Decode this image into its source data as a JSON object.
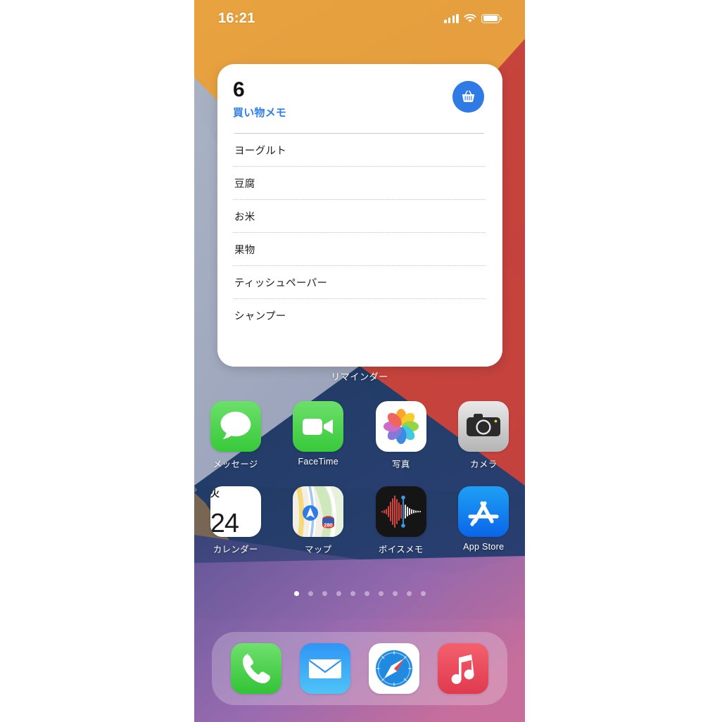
{
  "status_bar": {
    "time": "16:21",
    "signal_icon": "cellular-signal-icon",
    "wifi_icon": "wifi-icon",
    "battery_icon": "battery-full-icon"
  },
  "widget": {
    "count": "6",
    "title": "買い物メモ",
    "app_label": "リマインダー",
    "accent_color": "#2f7ae5",
    "icon": "shopping-basket-icon",
    "items": [
      {
        "label": "ヨーグルト"
      },
      {
        "label": "豆腐"
      },
      {
        "label": "お米"
      },
      {
        "label": "果物"
      },
      {
        "label": "ティッシュペーパー"
      },
      {
        "label": "シャンプー"
      }
    ]
  },
  "home_screen": {
    "rows": [
      {
        "apps": [
          {
            "label": "メッセージ",
            "icon": "messages-icon"
          },
          {
            "label": "FaceTime",
            "icon": "facetime-icon"
          },
          {
            "label": "写真",
            "icon": "photos-icon"
          },
          {
            "label": "カメラ",
            "icon": "camera-icon"
          }
        ]
      },
      {
        "apps": [
          {
            "label": "カレンダー",
            "icon": "calendar-icon",
            "weekday": "火",
            "day": "24"
          },
          {
            "label": "マップ",
            "icon": "maps-icon",
            "route_shield": "280"
          },
          {
            "label": "ボイスメモ",
            "icon": "voice-memos-icon"
          },
          {
            "label": "App Store",
            "icon": "app-store-icon"
          }
        ]
      }
    ],
    "page_dots": {
      "total": 10,
      "active_index": 0
    },
    "dock": [
      {
        "name": "phone-app",
        "icon": "phone-icon"
      },
      {
        "name": "mail-app",
        "icon": "mail-icon"
      },
      {
        "name": "safari-app",
        "icon": "safari-icon"
      },
      {
        "name": "music-app",
        "icon": "music-icon"
      }
    ]
  }
}
